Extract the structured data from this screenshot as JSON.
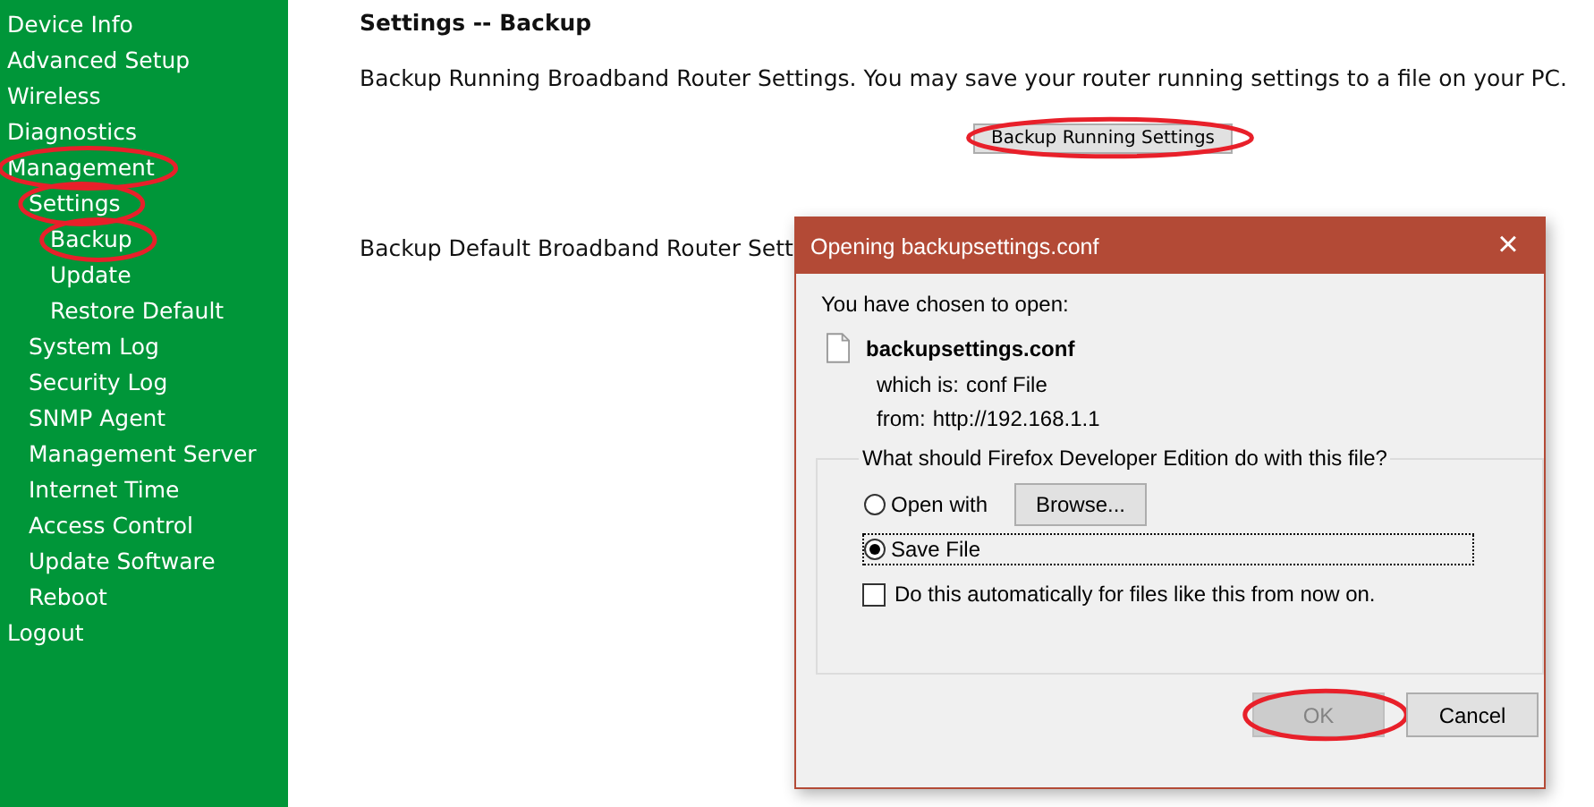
{
  "sidebar": {
    "items": [
      {
        "label": "Device Info",
        "circled": false
      },
      {
        "label": "Advanced Setup",
        "circled": false
      },
      {
        "label": "Wireless",
        "circled": false
      },
      {
        "label": "Diagnostics",
        "circled": false
      },
      {
        "label": "Management",
        "circled": true,
        "children": [
          {
            "label": "Settings",
            "circled": true,
            "children": [
              {
                "label": "Backup",
                "circled": true
              },
              {
                "label": "Update",
                "circled": false
              },
              {
                "label": "Restore Default",
                "circled": false
              }
            ]
          },
          {
            "label": "System Log",
            "circled": false
          },
          {
            "label": "Security Log",
            "circled": false
          },
          {
            "label": "SNMP Agent",
            "circled": false
          },
          {
            "label": "Management Server",
            "circled": false
          },
          {
            "label": "Internet Time",
            "circled": false
          },
          {
            "label": "Access Control",
            "circled": false
          },
          {
            "label": "Update Software",
            "circled": false
          },
          {
            "label": "Reboot",
            "circled": false
          }
        ]
      },
      {
        "label": "Logout",
        "circled": false
      }
    ]
  },
  "main": {
    "title": "Settings -- Backup",
    "running_text": "Backup Running Broadband Router Settings. You may save your router running settings to a file on your PC.",
    "running_button": {
      "label": "Backup Running Settings",
      "circled": true
    },
    "default_text": "Backup Default Broadband Router Sett"
  },
  "dialog": {
    "title": "Opening backupsettings.conf",
    "close": "×",
    "intro": "You have chosen to open:",
    "filename": "backupsettings.conf",
    "type_label": "which is:",
    "type_value": "conf File",
    "from_label": "from:",
    "from_value": "http://192.168.1.1",
    "question": "What should Firefox Developer Edition do with this file?",
    "options": [
      {
        "label": "Open with",
        "selected": false,
        "focused": false,
        "button": "Browse..."
      },
      {
        "label": "Save File",
        "selected": true,
        "focused": true
      }
    ],
    "auto": {
      "label": "Do this automatically for files like this from now on.",
      "checked": false
    },
    "buttons": [
      {
        "label": "OK",
        "disabled": true,
        "circled": true
      },
      {
        "label": "Cancel",
        "disabled": false,
        "circled": false
      }
    ]
  }
}
